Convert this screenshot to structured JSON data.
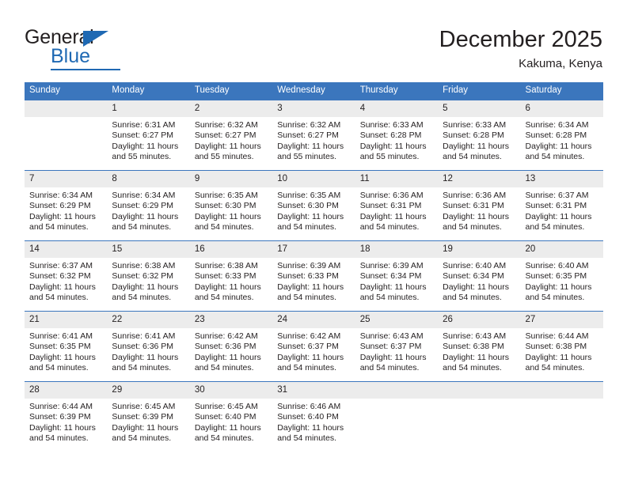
{
  "logo": {
    "word_top": "General",
    "word_bottom": "Blue",
    "accent_color": "#1f69b3"
  },
  "header": {
    "title": "December 2025",
    "subtitle": "Kakuma, Kenya"
  },
  "theme": {
    "header_blue": "#3b76bd",
    "daynum_band": "#ececec",
    "text": "#231f20"
  },
  "calendar": {
    "weekday_headers": [
      "Sunday",
      "Monday",
      "Tuesday",
      "Wednesday",
      "Thursday",
      "Friday",
      "Saturday"
    ],
    "weeks": [
      [
        {
          "day": "",
          "empty": true,
          "sunrise": "",
          "sunset": "",
          "daylight_line1": "",
          "daylight_line2": ""
        },
        {
          "day": "1",
          "sunrise": "Sunrise: 6:31 AM",
          "sunset": "Sunset: 6:27 PM",
          "daylight_line1": "Daylight: 11 hours",
          "daylight_line2": "and 55 minutes."
        },
        {
          "day": "2",
          "sunrise": "Sunrise: 6:32 AM",
          "sunset": "Sunset: 6:27 PM",
          "daylight_line1": "Daylight: 11 hours",
          "daylight_line2": "and 55 minutes."
        },
        {
          "day": "3",
          "sunrise": "Sunrise: 6:32 AM",
          "sunset": "Sunset: 6:27 PM",
          "daylight_line1": "Daylight: 11 hours",
          "daylight_line2": "and 55 minutes."
        },
        {
          "day": "4",
          "sunrise": "Sunrise: 6:33 AM",
          "sunset": "Sunset: 6:28 PM",
          "daylight_line1": "Daylight: 11 hours",
          "daylight_line2": "and 55 minutes."
        },
        {
          "day": "5",
          "sunrise": "Sunrise: 6:33 AM",
          "sunset": "Sunset: 6:28 PM",
          "daylight_line1": "Daylight: 11 hours",
          "daylight_line2": "and 54 minutes."
        },
        {
          "day": "6",
          "sunrise": "Sunrise: 6:34 AM",
          "sunset": "Sunset: 6:28 PM",
          "daylight_line1": "Daylight: 11 hours",
          "daylight_line2": "and 54 minutes."
        }
      ],
      [
        {
          "day": "7",
          "sunrise": "Sunrise: 6:34 AM",
          "sunset": "Sunset: 6:29 PM",
          "daylight_line1": "Daylight: 11 hours",
          "daylight_line2": "and 54 minutes."
        },
        {
          "day": "8",
          "sunrise": "Sunrise: 6:34 AM",
          "sunset": "Sunset: 6:29 PM",
          "daylight_line1": "Daylight: 11 hours",
          "daylight_line2": "and 54 minutes."
        },
        {
          "day": "9",
          "sunrise": "Sunrise: 6:35 AM",
          "sunset": "Sunset: 6:30 PM",
          "daylight_line1": "Daylight: 11 hours",
          "daylight_line2": "and 54 minutes."
        },
        {
          "day": "10",
          "sunrise": "Sunrise: 6:35 AM",
          "sunset": "Sunset: 6:30 PM",
          "daylight_line1": "Daylight: 11 hours",
          "daylight_line2": "and 54 minutes."
        },
        {
          "day": "11",
          "sunrise": "Sunrise: 6:36 AM",
          "sunset": "Sunset: 6:31 PM",
          "daylight_line1": "Daylight: 11 hours",
          "daylight_line2": "and 54 minutes."
        },
        {
          "day": "12",
          "sunrise": "Sunrise: 6:36 AM",
          "sunset": "Sunset: 6:31 PM",
          "daylight_line1": "Daylight: 11 hours",
          "daylight_line2": "and 54 minutes."
        },
        {
          "day": "13",
          "sunrise": "Sunrise: 6:37 AM",
          "sunset": "Sunset: 6:31 PM",
          "daylight_line1": "Daylight: 11 hours",
          "daylight_line2": "and 54 minutes."
        }
      ],
      [
        {
          "day": "14",
          "sunrise": "Sunrise: 6:37 AM",
          "sunset": "Sunset: 6:32 PM",
          "daylight_line1": "Daylight: 11 hours",
          "daylight_line2": "and 54 minutes."
        },
        {
          "day": "15",
          "sunrise": "Sunrise: 6:38 AM",
          "sunset": "Sunset: 6:32 PM",
          "daylight_line1": "Daylight: 11 hours",
          "daylight_line2": "and 54 minutes."
        },
        {
          "day": "16",
          "sunrise": "Sunrise: 6:38 AM",
          "sunset": "Sunset: 6:33 PM",
          "daylight_line1": "Daylight: 11 hours",
          "daylight_line2": "and 54 minutes."
        },
        {
          "day": "17",
          "sunrise": "Sunrise: 6:39 AM",
          "sunset": "Sunset: 6:33 PM",
          "daylight_line1": "Daylight: 11 hours",
          "daylight_line2": "and 54 minutes."
        },
        {
          "day": "18",
          "sunrise": "Sunrise: 6:39 AM",
          "sunset": "Sunset: 6:34 PM",
          "daylight_line1": "Daylight: 11 hours",
          "daylight_line2": "and 54 minutes."
        },
        {
          "day": "19",
          "sunrise": "Sunrise: 6:40 AM",
          "sunset": "Sunset: 6:34 PM",
          "daylight_line1": "Daylight: 11 hours",
          "daylight_line2": "and 54 minutes."
        },
        {
          "day": "20",
          "sunrise": "Sunrise: 6:40 AM",
          "sunset": "Sunset: 6:35 PM",
          "daylight_line1": "Daylight: 11 hours",
          "daylight_line2": "and 54 minutes."
        }
      ],
      [
        {
          "day": "21",
          "sunrise": "Sunrise: 6:41 AM",
          "sunset": "Sunset: 6:35 PM",
          "daylight_line1": "Daylight: 11 hours",
          "daylight_line2": "and 54 minutes."
        },
        {
          "day": "22",
          "sunrise": "Sunrise: 6:41 AM",
          "sunset": "Sunset: 6:36 PM",
          "daylight_line1": "Daylight: 11 hours",
          "daylight_line2": "and 54 minutes."
        },
        {
          "day": "23",
          "sunrise": "Sunrise: 6:42 AM",
          "sunset": "Sunset: 6:36 PM",
          "daylight_line1": "Daylight: 11 hours",
          "daylight_line2": "and 54 minutes."
        },
        {
          "day": "24",
          "sunrise": "Sunrise: 6:42 AM",
          "sunset": "Sunset: 6:37 PM",
          "daylight_line1": "Daylight: 11 hours",
          "daylight_line2": "and 54 minutes."
        },
        {
          "day": "25",
          "sunrise": "Sunrise: 6:43 AM",
          "sunset": "Sunset: 6:37 PM",
          "daylight_line1": "Daylight: 11 hours",
          "daylight_line2": "and 54 minutes."
        },
        {
          "day": "26",
          "sunrise": "Sunrise: 6:43 AM",
          "sunset": "Sunset: 6:38 PM",
          "daylight_line1": "Daylight: 11 hours",
          "daylight_line2": "and 54 minutes."
        },
        {
          "day": "27",
          "sunrise": "Sunrise: 6:44 AM",
          "sunset": "Sunset: 6:38 PM",
          "daylight_line1": "Daylight: 11 hours",
          "daylight_line2": "and 54 minutes."
        }
      ],
      [
        {
          "day": "28",
          "sunrise": "Sunrise: 6:44 AM",
          "sunset": "Sunset: 6:39 PM",
          "daylight_line1": "Daylight: 11 hours",
          "daylight_line2": "and 54 minutes."
        },
        {
          "day": "29",
          "sunrise": "Sunrise: 6:45 AM",
          "sunset": "Sunset: 6:39 PM",
          "daylight_line1": "Daylight: 11 hours",
          "daylight_line2": "and 54 minutes."
        },
        {
          "day": "30",
          "sunrise": "Sunrise: 6:45 AM",
          "sunset": "Sunset: 6:40 PM",
          "daylight_line1": "Daylight: 11 hours",
          "daylight_line2": "and 54 minutes."
        },
        {
          "day": "31",
          "sunrise": "Sunrise: 6:46 AM",
          "sunset": "Sunset: 6:40 PM",
          "daylight_line1": "Daylight: 11 hours",
          "daylight_line2": "and 54 minutes."
        },
        {
          "day": "",
          "empty": true,
          "sunrise": "",
          "sunset": "",
          "daylight_line1": "",
          "daylight_line2": ""
        },
        {
          "day": "",
          "empty": true,
          "sunrise": "",
          "sunset": "",
          "daylight_line1": "",
          "daylight_line2": ""
        },
        {
          "day": "",
          "empty": true,
          "sunrise": "",
          "sunset": "",
          "daylight_line1": "",
          "daylight_line2": ""
        }
      ]
    ]
  }
}
